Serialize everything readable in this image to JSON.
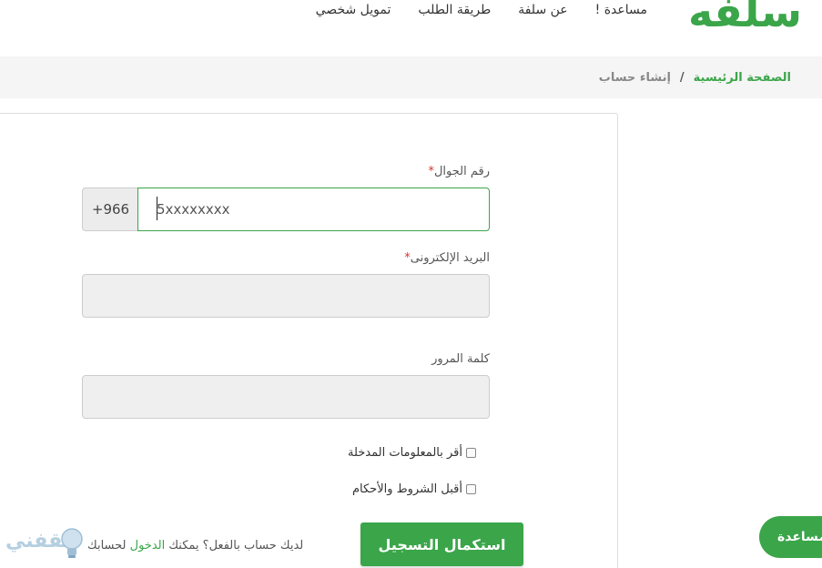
{
  "header": {
    "logo": "سلفه",
    "nav": [
      "تمويل شخصي",
      "طريقة الطلب",
      "عن سلفة",
      "مساعدة !"
    ]
  },
  "breadcrumb": {
    "home": "الصفحة الرئيسية",
    "separator": "/",
    "current": "إنشاء حساب"
  },
  "form": {
    "phone": {
      "label": "رقم الجوال",
      "required_mark": "*",
      "prefix": "+966",
      "placeholder": "5xxxxxxxx"
    },
    "email": {
      "label": "البريد الإلكترونى",
      "required_mark": "*",
      "value": ""
    },
    "password": {
      "label": "كلمة المرور",
      "value": ""
    },
    "confirm_info": "أقر بالمعلومات المدخلة",
    "accept_terms": "أقبل الشروط والأحكام",
    "submit_label": "استكمال التسجيل",
    "login_prompt_before": "لديك حساب بالفعل؟ يمكنك ",
    "login_link": "الدخول",
    "login_prompt_after": " لحسابك"
  },
  "help_button": "مساعدة",
  "watermark": "ثقفني",
  "colors": {
    "brand_green": "#3ba54a",
    "required_red": "#d9342b"
  }
}
